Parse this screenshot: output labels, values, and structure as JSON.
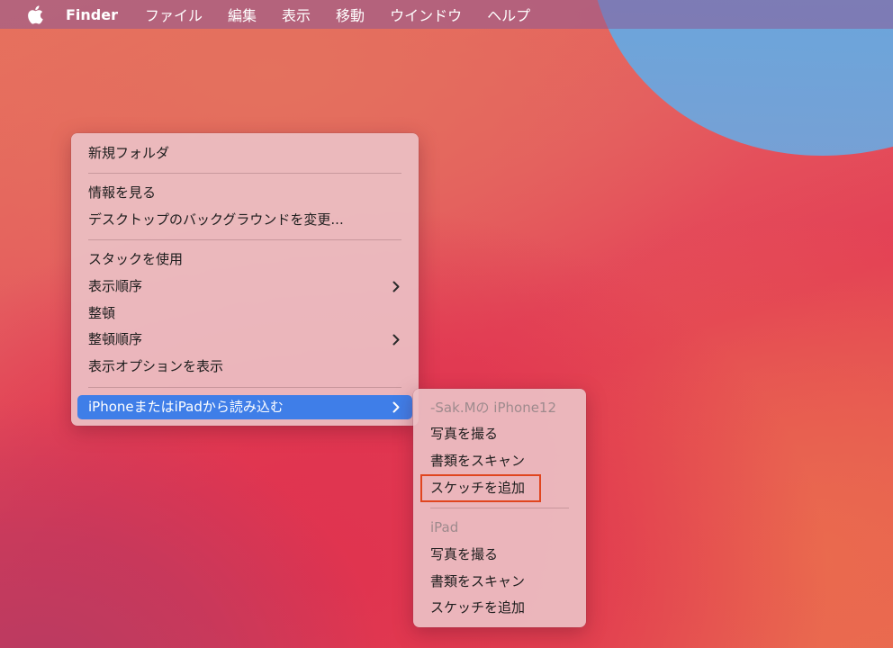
{
  "menubar": {
    "apple_icon": "apple-logo-icon",
    "items": [
      "Finder",
      "ファイル",
      "編集",
      "表示",
      "移動",
      "ウインドウ",
      "ヘルプ"
    ]
  },
  "context_menu": {
    "items": {
      "new_folder": "新規フォルダ",
      "get_info": "情報を見る",
      "change_background": "デスクトップのバックグラウンドを変更...",
      "use_stacks": "スタックを使用",
      "sort_by": "表示順序",
      "clean_up": "整頓",
      "clean_up_by": "整頓順序",
      "show_view_options": "表示オプションを表示",
      "import_from_device": "iPhoneまたはiPadから読み込む"
    },
    "chevron_icon": "chevron-right-icon"
  },
  "submenu": {
    "iphone_header": "-Sak.Mの iPhone12",
    "iphone_take_photo": "写真を撮る",
    "iphone_scan_documents": "書類をスキャン",
    "iphone_add_sketch": "スケッチを追加",
    "ipad_header": "iPad",
    "ipad_take_photo": "写真を撮る",
    "ipad_scan_documents": "書類をスキャン",
    "ipad_add_sketch": "スケッチを追加"
  },
  "colors": {
    "selection": "#3f7ee8",
    "annotation_box": "#e0451f"
  }
}
